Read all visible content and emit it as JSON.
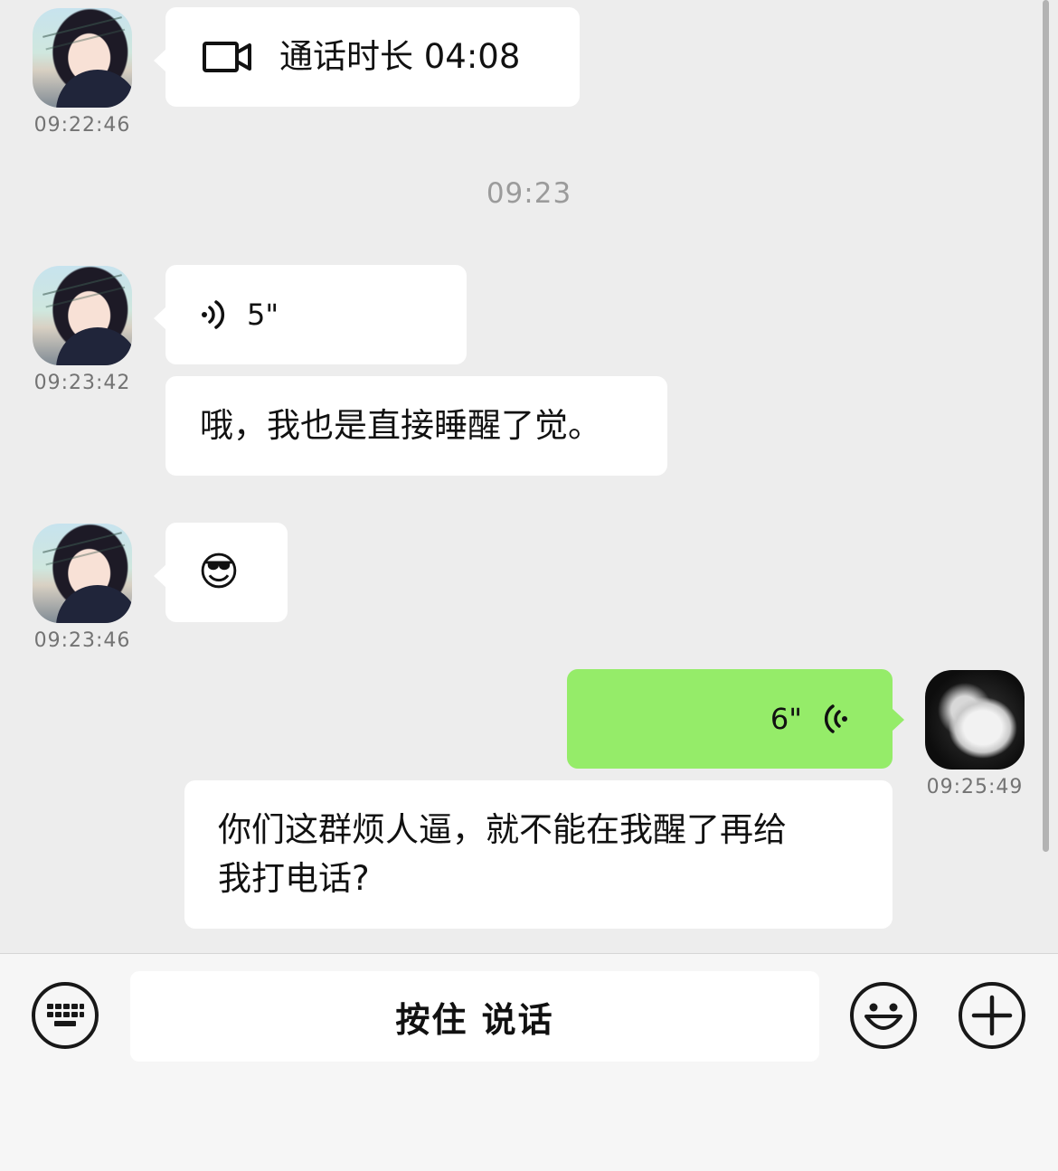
{
  "messages": [
    {
      "sender": "other",
      "type": "video_call",
      "text": "通话时长 04:08",
      "time": "09:22:46"
    },
    {
      "divider_time": "09:23"
    },
    {
      "sender": "other",
      "type": "voice",
      "duration": "5\"",
      "time": "09:23:42"
    },
    {
      "sender": "other",
      "type": "text",
      "text": "哦，我也是直接睡醒了觉。"
    },
    {
      "sender": "other",
      "type": "emoji",
      "emoji": "😎",
      "time": "09:23:46"
    },
    {
      "sender": "me",
      "type": "voice",
      "duration": "6\"",
      "time": "09:25:49"
    },
    {
      "sender": "me",
      "type": "text",
      "lines": [
        "你们这群烦人逼，就不能在我醒了再给",
        "我打电话?"
      ]
    }
  ],
  "input_bar": {
    "hold_to_talk": "按住 说话",
    "icons": [
      "keyboard-icon",
      "emoji-icon",
      "plus-icon"
    ]
  },
  "colors": {
    "background": "#ededed",
    "my_bubble": "#95ec69",
    "other_bubble": "#ffffff"
  }
}
